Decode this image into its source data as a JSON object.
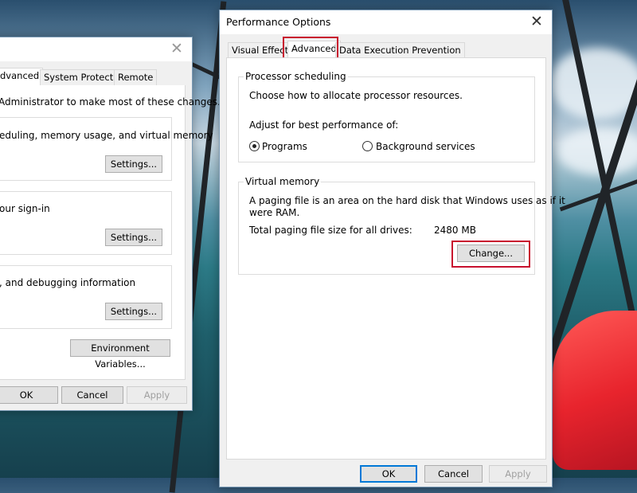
{
  "background_dialog": {
    "tabs": [
      "dvanced",
      "System Protection",
      "Remote"
    ],
    "admin_note": "Administrator to make most of these changes.",
    "sections": [
      {
        "text": "eduling, memory usage, and virtual memory",
        "button": "Settings..."
      },
      {
        "text": "our sign-in",
        "button": "Settings..."
      },
      {
        "text": ", and debugging information",
        "button": "Settings..."
      }
    ],
    "env_button": "Environment Variables...",
    "ok": "OK",
    "cancel": "Cancel",
    "apply": "Apply"
  },
  "perf_dialog": {
    "title": "Performance Options",
    "tabs": [
      "Visual Effects",
      "Advanced",
      "Data Execution Prevention"
    ],
    "active_tab": "Advanced",
    "processor": {
      "title": "Processor scheduling",
      "description": "Choose how to allocate processor resources.",
      "adjust_label": "Adjust for best performance of:",
      "options": [
        "Programs",
        "Background services"
      ],
      "selected": "Programs"
    },
    "virtual_memory": {
      "title": "Virtual memory",
      "description_line1": "A paging file is an area on the hard disk that Windows uses as if it",
      "description_line2": "were RAM.",
      "total_label": "Total paging file size for all drives:",
      "total_value": "2480 MB",
      "change_button": "Change..."
    },
    "ok": "OK",
    "cancel": "Cancel",
    "apply": "Apply"
  },
  "colors": {
    "highlight": "#c8102e",
    "accent": "#0078d7"
  }
}
